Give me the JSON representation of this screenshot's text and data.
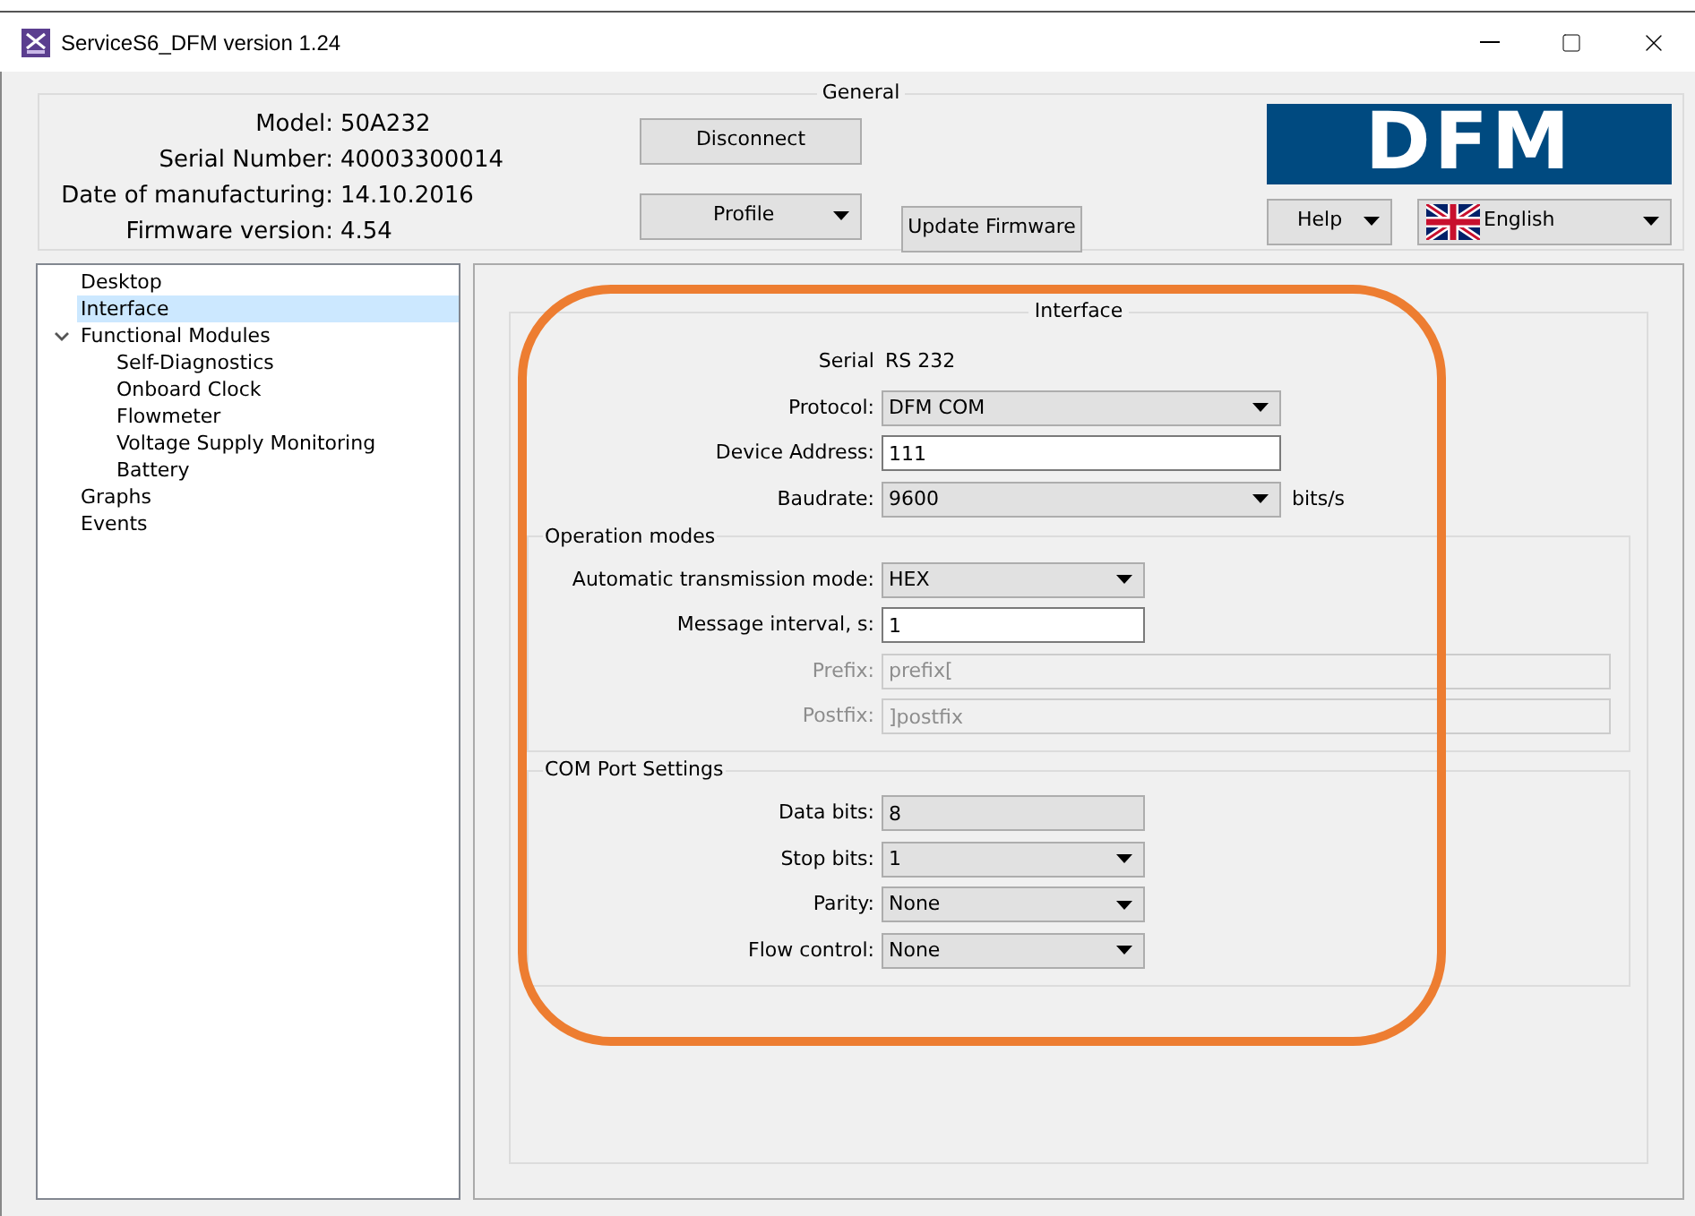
{
  "window": {
    "title": "ServiceS6_DFM version 1.24"
  },
  "general": {
    "title": "General",
    "info": [
      {
        "label": "Model:",
        "value": "50A232"
      },
      {
        "label": "Serial Number:",
        "value": "40003300014"
      },
      {
        "label": "Date of manufacturing:",
        "value": "14.10.2016"
      },
      {
        "label": "Firmware version:",
        "value": "4.54"
      }
    ],
    "disconnect": "Disconnect",
    "profile": "Profile",
    "update_firmware": "Update Firmware",
    "logo": "DFM",
    "help": "Help",
    "language": "English"
  },
  "tree": [
    {
      "label": "Desktop",
      "selected": false
    },
    {
      "label": "Interface",
      "selected": true
    },
    {
      "label": "Functional Modules",
      "selected": false,
      "expanded": true,
      "children": [
        {
          "label": "Self-Diagnostics",
          "selected": false
        },
        {
          "label": "Onboard Clock",
          "selected": false
        },
        {
          "label": "Flowmeter",
          "selected": false
        },
        {
          "label": "Voltage Supply Monitoring",
          "selected": false
        },
        {
          "label": "Battery",
          "selected": false
        }
      ]
    },
    {
      "label": "Graphs",
      "selected": false
    },
    {
      "label": "Events",
      "selected": false
    }
  ],
  "interface": {
    "title": "Interface",
    "rows": [
      {
        "kind": "text",
        "label": "Serial",
        "value": "RS 232"
      },
      {
        "kind": "combo",
        "label": "Protocol:",
        "value": "DFM COM"
      },
      {
        "kind": "input",
        "label": "Device Address:",
        "value": "111"
      },
      {
        "kind": "combo",
        "label": "Baudrate:",
        "value": "9600",
        "unit": "bits/s"
      }
    ],
    "groups": [
      {
        "title": "Operation modes",
        "rows": [
          {
            "kind": "combo",
            "label": "Automatic transmission mode:",
            "value": "HEX"
          },
          {
            "kind": "input",
            "label": "Message interval, s:",
            "value": "1"
          },
          {
            "kind": "disabled",
            "label": "Prefix:",
            "value": "prefix["
          },
          {
            "kind": "disabled",
            "label": "Postfix:",
            "value": "]postfix"
          }
        ]
      },
      {
        "title": "COM Port Settings",
        "rows": [
          {
            "kind": "readonly",
            "label": "Data bits:",
            "value": "8"
          },
          {
            "kind": "combo",
            "label": "Stop bits:",
            "value": "1"
          },
          {
            "kind": "combo",
            "label": "Parity:",
            "value": "None"
          },
          {
            "kind": "combo",
            "label": "Flow control:",
            "value": "None"
          }
        ]
      }
    ]
  }
}
